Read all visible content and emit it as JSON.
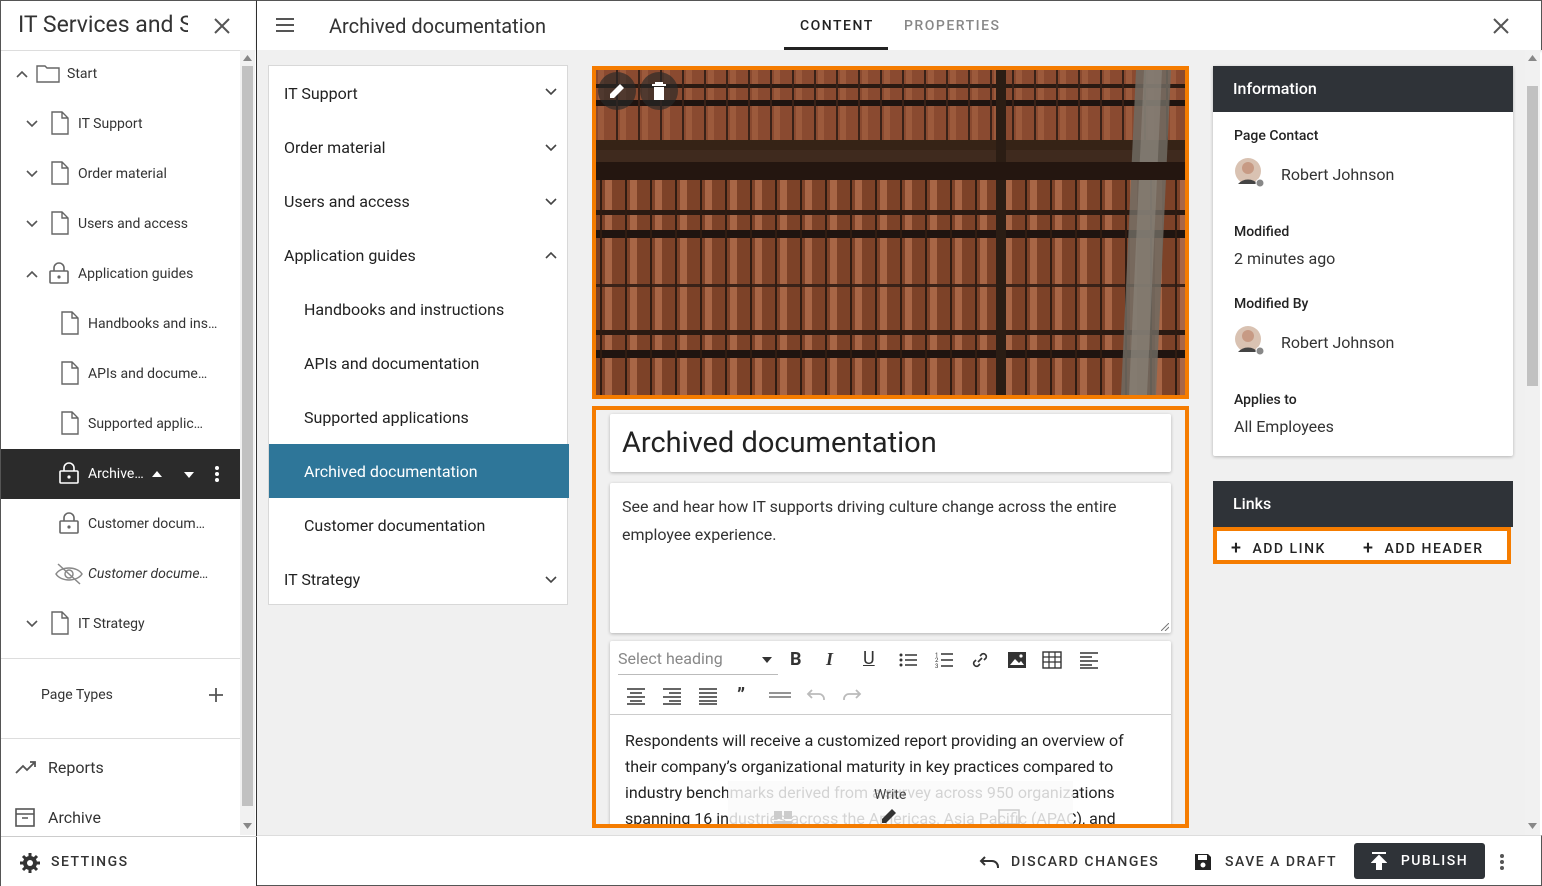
{
  "app": {
    "title": "IT Services and Support"
  },
  "tree": {
    "items": [
      {
        "label": "Start"
      },
      {
        "label": "IT Support"
      },
      {
        "label": "Order material"
      },
      {
        "label": "Users and access"
      },
      {
        "label": "Application guides"
      },
      {
        "label": "Handbooks and instructions"
      },
      {
        "label": "APIs and documentation"
      },
      {
        "label": "Supported applications"
      },
      {
        "label": "Archived documentation"
      },
      {
        "label": "Customer documentation"
      },
      {
        "label": "Customer documentation"
      },
      {
        "label": "IT Strategy"
      }
    ],
    "page_types": "Page Types",
    "reports": "Reports",
    "archive": "Archive",
    "settings": "SETTINGS"
  },
  "header": {
    "title": "Archived documentation",
    "tabs": [
      {
        "label": "CONTENT"
      },
      {
        "label": "PROPERTIES"
      }
    ]
  },
  "nav": {
    "items": [
      {
        "label": "IT Support"
      },
      {
        "label": "Order material"
      },
      {
        "label": "Users and access"
      },
      {
        "label": "Application guides"
      },
      {
        "label": "Handbooks and instructions"
      },
      {
        "label": "APIs and documentation"
      },
      {
        "label": "Supported applications"
      },
      {
        "label": "Archived documentation"
      },
      {
        "label": "Customer documentation"
      },
      {
        "label": "IT Strategy"
      }
    ]
  },
  "content": {
    "title": "Archived documentation",
    "intro": "See and hear how IT supports driving culture change across the entire employee experience.",
    "editor": {
      "heading_placeholder": "Select heading",
      "body": "Respondents will receive a customized report providing an overview of their company’s organizational maturity in key practices compared to industry benchmarks derived from a survey across 950 organizations spanning 16 industries across the Americas, Asia Pacific (APAC), and"
    },
    "overlay": {
      "write_label": "Write"
    }
  },
  "info": {
    "header": "Information",
    "page_contact_label": "Page Contact",
    "page_contact": "Robert Johnson",
    "modified_label": "Modified",
    "modified": "2 minutes ago",
    "modified_by_label": "Modified By",
    "modified_by": "Robert Johnson",
    "applies_to_label": "Applies to",
    "applies_to": "All Employees"
  },
  "links": {
    "header": "Links",
    "add_link": "ADD LINK",
    "add_header": "ADD HEADER"
  },
  "footer": {
    "discard": "DISCARD CHANGES",
    "save_draft": "SAVE A DRAFT",
    "publish": "PUBLISH"
  },
  "colors": {
    "accent": "#f57c00",
    "selected_nav": "#2e7699",
    "dark": "#2f3338"
  }
}
